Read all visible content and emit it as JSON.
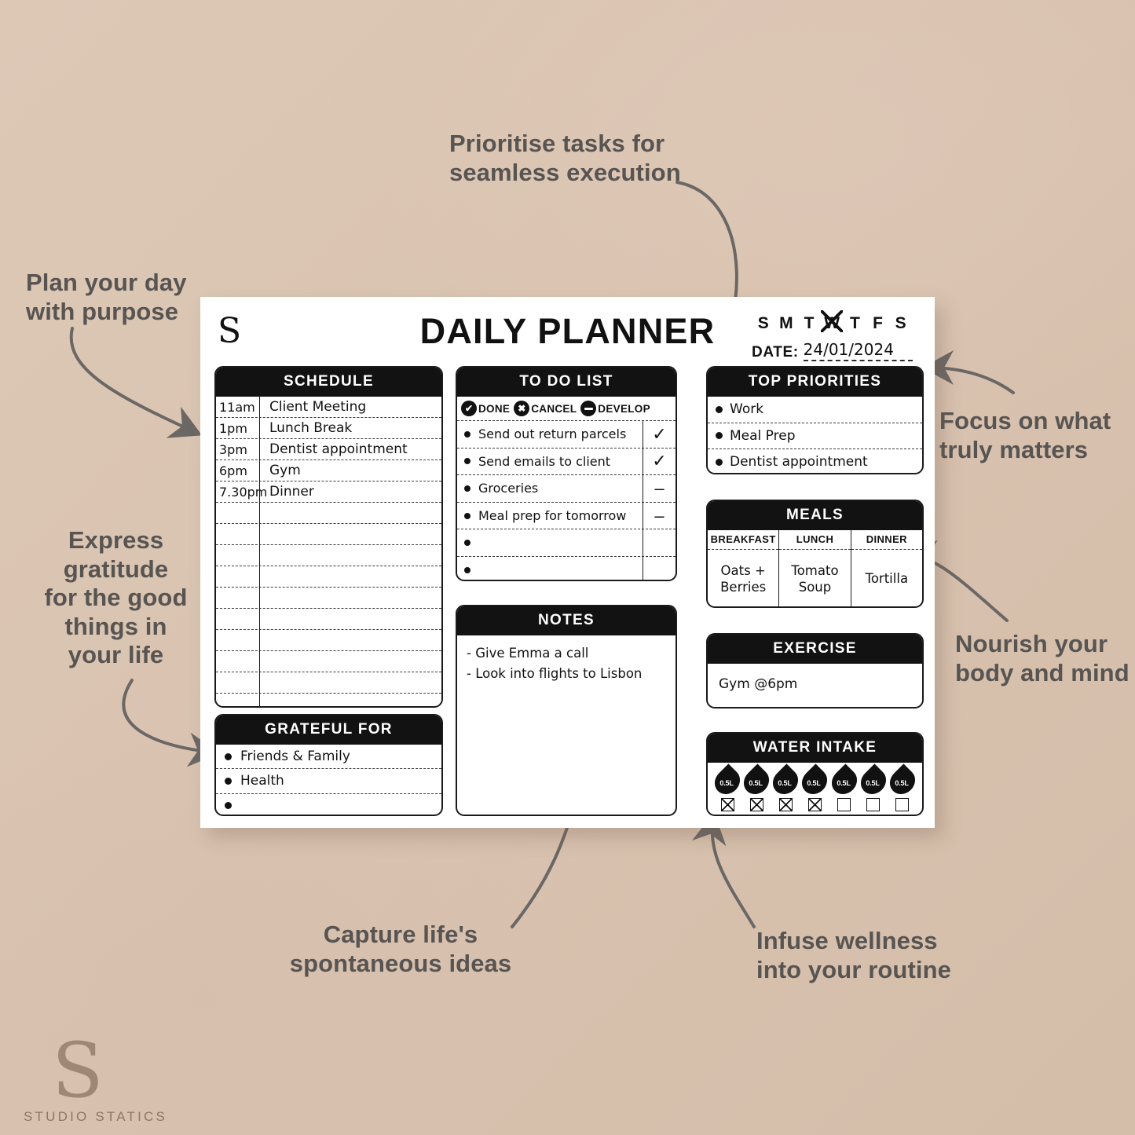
{
  "theme": {
    "background": "#dcc5b2",
    "ink": "#111111",
    "header_bg": "#121212",
    "caption_color": "#575452",
    "sheet_bg": "#ffffff"
  },
  "planner": {
    "brand_mark": "S",
    "title": "DAILY PLANNER",
    "days": [
      {
        "label": "S",
        "marked": false
      },
      {
        "label": "M",
        "marked": false
      },
      {
        "label": "T",
        "marked": false
      },
      {
        "label": "W",
        "marked": true
      },
      {
        "label": "T",
        "marked": false
      },
      {
        "label": "F",
        "marked": false
      },
      {
        "label": "S",
        "marked": false
      }
    ],
    "date_label": "DATE:",
    "date_value": "24/01/2024",
    "schedule": {
      "title": "SCHEDULE",
      "rows": [
        {
          "time": "11am",
          "task": "Client Meeting"
        },
        {
          "time": "1pm",
          "task": "Lunch Break"
        },
        {
          "time": "3pm",
          "task": "Dentist appointment"
        },
        {
          "time": "6pm",
          "task": "Gym"
        },
        {
          "time": "7.30pm",
          "task": "Dinner"
        },
        {
          "time": "",
          "task": ""
        },
        {
          "time": "",
          "task": ""
        },
        {
          "time": "",
          "task": ""
        },
        {
          "time": "",
          "task": ""
        },
        {
          "time": "",
          "task": ""
        },
        {
          "time": "",
          "task": ""
        },
        {
          "time": "",
          "task": ""
        },
        {
          "time": "",
          "task": ""
        },
        {
          "time": "",
          "task": ""
        },
        {
          "time": "",
          "task": ""
        }
      ]
    },
    "todo": {
      "title": "TO DO LIST",
      "legend": [
        {
          "icon": "check-circle-icon",
          "glyph": "✔",
          "label": "DONE"
        },
        {
          "icon": "x-circle-icon",
          "glyph": "✖",
          "label": "CANCEL"
        },
        {
          "icon": "minus-circle-icon",
          "glyph": "",
          "label": "DEVELOP"
        }
      ],
      "rows": [
        {
          "task": "Send out return parcels",
          "mark": "✓"
        },
        {
          "task": "Send emails to client",
          "mark": "✓"
        },
        {
          "task": "Groceries",
          "mark": "–"
        },
        {
          "task": "Meal prep for tomorrow",
          "mark": "–"
        },
        {
          "task": "",
          "mark": ""
        },
        {
          "task": "",
          "mark": ""
        }
      ]
    },
    "notes": {
      "title": "NOTES",
      "lines": [
        "- Give Emma a call",
        "- Look into flights to Lisbon"
      ]
    },
    "priorities": {
      "title": "TOP PRIORITIES",
      "items": [
        "Work",
        "Meal Prep",
        "Dentist appointment"
      ]
    },
    "meals": {
      "title": "MEALS",
      "columns": [
        {
          "header": "BREAKFAST",
          "value": "Oats +\nBerries"
        },
        {
          "header": "LUNCH",
          "value": "Tomato\nSoup"
        },
        {
          "header": "DINNER",
          "value": "Tortilla"
        }
      ]
    },
    "exercise": {
      "title": "EXERCISE",
      "value": "Gym @6pm"
    },
    "water": {
      "title": "WATER INTAKE",
      "unit_label": "0.5L",
      "units": [
        {
          "label": "0.5L",
          "checked": true
        },
        {
          "label": "0.5L",
          "checked": true
        },
        {
          "label": "0.5L",
          "checked": true
        },
        {
          "label": "0.5L",
          "checked": true
        },
        {
          "label": "0.5L",
          "checked": false
        },
        {
          "label": "0.5L",
          "checked": false
        },
        {
          "label": "0.5L",
          "checked": false
        }
      ]
    },
    "grateful": {
      "title": "GRATEFUL FOR",
      "items": [
        "Friends & Family",
        "Health",
        ""
      ]
    }
  },
  "callouts": [
    {
      "id": "plan-day",
      "text": "Plan your day\nwith purpose"
    },
    {
      "id": "prioritise",
      "text": "Prioritise tasks for\nseamless execution"
    },
    {
      "id": "focus",
      "text": "Focus on what\ntruly matters"
    },
    {
      "id": "gratitude",
      "text": "Express\ngratitude\nfor the good\nthings in\nyour life"
    },
    {
      "id": "nourish",
      "text": "Nourish your\nbody and mind"
    },
    {
      "id": "capture",
      "text": "Capture life's\nspontaneous ideas"
    },
    {
      "id": "wellness",
      "text": "Infuse wellness\ninto your routine"
    }
  ],
  "watermark": {
    "glyph": "S",
    "name": "STUDIO STATICS"
  }
}
